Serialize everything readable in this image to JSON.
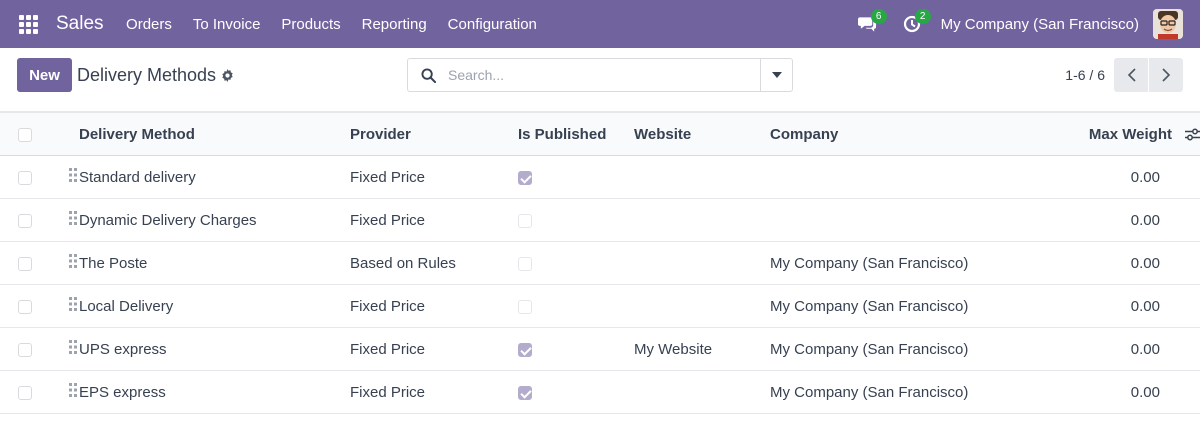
{
  "navbar": {
    "app_name": "Sales",
    "menu": [
      "Orders",
      "To Invoice",
      "Products",
      "Reporting",
      "Configuration"
    ],
    "messages_count": "6",
    "activities_count": "2",
    "company": "My Company (San Francisco)",
    "icons": {
      "apps": "apps-grid-icon",
      "messages": "chat-icon",
      "activities": "clock-icon",
      "avatar": "user-avatar"
    },
    "color": "#71639e"
  },
  "control": {
    "new_label": "New",
    "title": "Delivery Methods",
    "search_placeholder": "Search...",
    "pager": "1-6 / 6"
  },
  "table": {
    "headers": {
      "method": "Delivery Method",
      "provider": "Provider",
      "published": "Is Published",
      "website": "Website",
      "company": "Company",
      "max_weight": "Max Weight"
    },
    "rows": [
      {
        "method": "Standard delivery",
        "provider": "Fixed Price",
        "published": true,
        "website": "",
        "company": "",
        "max_weight": "0.00"
      },
      {
        "method": "Dynamic Delivery Charges",
        "provider": "Fixed Price",
        "published": false,
        "website": "",
        "company": "",
        "max_weight": "0.00"
      },
      {
        "method": "The Poste",
        "provider": "Based on Rules",
        "published": false,
        "website": "",
        "company": "My Company (San Francisco)",
        "max_weight": "0.00"
      },
      {
        "method": "Local Delivery",
        "provider": "Fixed Price",
        "published": false,
        "website": "",
        "company": "My Company (San Francisco)",
        "max_weight": "0.00"
      },
      {
        "method": "UPS express",
        "provider": "Fixed Price",
        "published": true,
        "website": "My Website",
        "company": "My Company (San Francisco)",
        "max_weight": "0.00"
      },
      {
        "method": "EPS express",
        "provider": "Fixed Price",
        "published": true,
        "website": "",
        "company": "My Company (San Francisco)",
        "max_weight": "0.00"
      }
    ]
  }
}
